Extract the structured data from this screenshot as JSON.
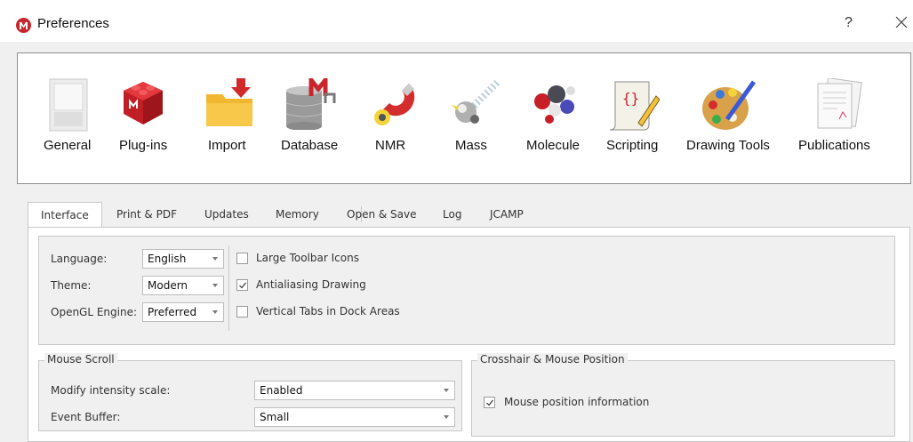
{
  "window": {
    "title": "Preferences",
    "help": "?"
  },
  "categories": [
    {
      "label": "General",
      "icon": "switch-icon"
    },
    {
      "label": "Plug-ins",
      "icon": "plugin-brick-icon"
    },
    {
      "label": "Import",
      "icon": "import-folder-icon"
    },
    {
      "label": "Database",
      "icon": "database-icon"
    },
    {
      "label": "NMR",
      "icon": "nmr-magnet-icon"
    },
    {
      "label": "Mass",
      "icon": "mass-spec-icon"
    },
    {
      "label": "Molecule",
      "icon": "molecule-icon"
    },
    {
      "label": "Scripting",
      "icon": "script-scroll-icon"
    },
    {
      "label": "Drawing Tools",
      "icon": "palette-icon"
    },
    {
      "label": "Publications",
      "icon": "publications-icon"
    }
  ],
  "tabs": [
    "Interface",
    "Print & PDF",
    "Updates",
    "Memory",
    "Open & Save",
    "Log",
    "JCAMP"
  ],
  "active_tab": "Interface",
  "interface": {
    "language": {
      "label": "Language:",
      "value": "English"
    },
    "theme": {
      "label": "Theme:",
      "value": "Modern"
    },
    "opengl": {
      "label": "OpenGL Engine:",
      "value": "Preferred"
    },
    "large_icons": {
      "label": "Large Toolbar Icons",
      "checked": false
    },
    "antialiasing": {
      "label": "Antialiasing Drawing",
      "checked": true
    },
    "vertical_tabs": {
      "label": "Vertical Tabs in Dock Areas",
      "checked": false
    }
  },
  "mouse_scroll": {
    "title": "Mouse Scroll",
    "intensity": {
      "label": "Modify intensity scale:",
      "value": "Enabled"
    },
    "buffer": {
      "label": "Event Buffer:",
      "value": "Small"
    }
  },
  "crosshair": {
    "title": "Crosshair & Mouse Position",
    "mouse_info": {
      "label": "Mouse position information",
      "checked": true
    }
  },
  "colors": {
    "brand": "#c8262d"
  }
}
